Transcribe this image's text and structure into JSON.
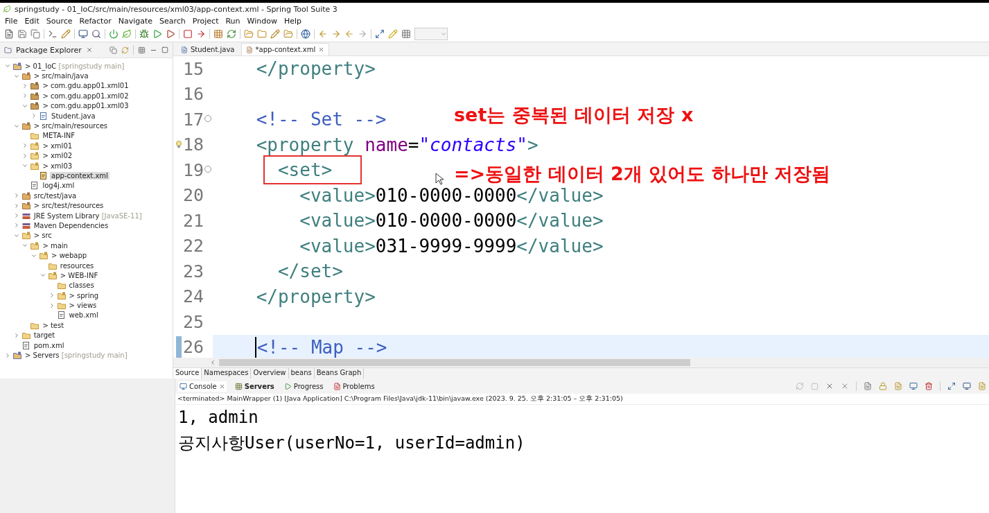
{
  "window": {
    "title": "springstudy - 01_IoC/src/main/resources/xml03/app-context.xml - Spring Tool Suite 3"
  },
  "menu": [
    "File",
    "Edit",
    "Source",
    "Refactor",
    "Navigate",
    "Search",
    "Project",
    "Run",
    "Window",
    "Help"
  ],
  "package_explorer": {
    "title": "Package Explorer",
    "items": [
      {
        "label": "> 01_IoC",
        "decoration": "[springstudy main]",
        "kind": "project",
        "expanded": true,
        "selected": false,
        "children": [
          {
            "label": "> src/main/java",
            "kind": "srcfolder",
            "expanded": true,
            "selected": false,
            "children": [
              {
                "label": "> com.gdu.app01.xml01",
                "kind": "package",
                "expanded": false,
                "selected": false
              },
              {
                "label": "> com.gdu.app01.xml02",
                "kind": "package",
                "expanded": false,
                "selected": false
              },
              {
                "label": "> com.gdu.app01.xml03",
                "kind": "package",
                "expanded": true,
                "selected": false,
                "children": [
                  {
                    "label": "Student.java",
                    "kind": "java",
                    "expanded": false,
                    "selected": false
                  }
                ]
              }
            ]
          },
          {
            "label": "> src/main/resources",
            "kind": "srcfolder",
            "expanded": true,
            "selected": false,
            "children": [
              {
                "label": "META-INF",
                "kind": "folder",
                "selected": false
              },
              {
                "label": "> xml01",
                "kind": "springfolder",
                "expanded": false,
                "selected": false
              },
              {
                "label": "> xml02",
                "kind": "springfolder",
                "expanded": false,
                "selected": false
              },
              {
                "label": "> xml03",
                "kind": "springfolder",
                "expanded": true,
                "selected": false,
                "children": [
                  {
                    "label": "app-context.xml",
                    "kind": "springxml",
                    "selected": true
                  }
                ]
              },
              {
                "label": "log4j.xml",
                "kind": "xml",
                "selected": false
              }
            ]
          },
          {
            "label": "src/test/java",
            "kind": "srcfolder",
            "expanded": false,
            "selected": false
          },
          {
            "label": "> src/test/resources",
            "kind": "srcfolder",
            "expanded": false,
            "selected": false
          },
          {
            "label": "JRE System Library",
            "decoration": "[JavaSE-11]",
            "kind": "library",
            "expanded": false,
            "selected": false
          },
          {
            "label": "Maven Dependencies",
            "kind": "library",
            "expanded": false,
            "selected": false
          },
          {
            "label": "> src",
            "kind": "springfolder",
            "expanded": true,
            "selected": false,
            "children": [
              {
                "label": "> main",
                "kind": "springfolder",
                "expanded": true,
                "selected": false,
                "children": [
                  {
                    "label": "> webapp",
                    "kind": "springfolder",
                    "expanded": true,
                    "selected": false,
                    "children": [
                      {
                        "label": "resources",
                        "kind": "folder",
                        "selected": false
                      },
                      {
                        "label": "> WEB-INF",
                        "kind": "springfolder",
                        "expanded": true,
                        "selected": false,
                        "children": [
                          {
                            "label": "classes",
                            "kind": "folder",
                            "selected": false
                          },
                          {
                            "label": "> spring",
                            "kind": "springfolder",
                            "expanded": false,
                            "selected": false
                          },
                          {
                            "label": "> views",
                            "kind": "folder",
                            "expanded": false,
                            "selected": false
                          },
                          {
                            "label": "web.xml",
                            "kind": "xml",
                            "selected": false
                          }
                        ]
                      }
                    ]
                  }
                ]
              },
              {
                "label": "> test",
                "kind": "folder",
                "selected": false
              }
            ]
          },
          {
            "label": "target",
            "kind": "folder",
            "expanded": false,
            "selected": false
          },
          {
            "label": "pom.xml",
            "kind": "xml",
            "selected": false
          }
        ]
      },
      {
        "label": "> Servers",
        "decoration": "[springstudy main]",
        "kind": "project",
        "expanded": false,
        "selected": false
      }
    ]
  },
  "editor": {
    "tabs": [
      {
        "label": "Student.java",
        "kind": "java",
        "selected": false
      },
      {
        "label": "*app-context.xml",
        "kind": "xml",
        "selected": true
      }
    ],
    "lines": [
      {
        "number": "15",
        "current": false,
        "foldable": false,
        "gutter_mark": false,
        "tokens": [
          {
            "kind": "tag",
            "text": "    </property>"
          }
        ]
      },
      {
        "number": "16",
        "current": false,
        "foldable": false,
        "gutter_mark": false
      },
      {
        "number": "17",
        "current": false,
        "foldable": true,
        "gutter_mark": false,
        "tokens": [
          {
            "kind": "comment",
            "text": "    <!-- Set -->"
          }
        ]
      },
      {
        "number": "18",
        "current": false,
        "foldable": false,
        "gutter_mark": true,
        "tokens": [
          {
            "kind": "tag",
            "text": "    <property"
          },
          {
            "kind": "attr",
            "text": " name"
          },
          {
            "kind": "text",
            "text": "="
          },
          {
            "kind": "string",
            "text": "\"contacts\""
          },
          {
            "kind": "tag",
            "text": ">"
          }
        ]
      },
      {
        "number": "19",
        "current": false,
        "foldable": true,
        "gutter_mark": false,
        "tokens": [
          {
            "kind": "tag",
            "text": "      <set>"
          }
        ]
      },
      {
        "number": "20",
        "current": false,
        "foldable": false,
        "gutter_mark": false,
        "tokens": [
          {
            "kind": "tag",
            "text": "        <value>"
          },
          {
            "kind": "text",
            "text": "010-0000-0000"
          },
          {
            "kind": "tag",
            "text": "</value>"
          }
        ]
      },
      {
        "number": "21",
        "current": false,
        "foldable": false,
        "gutter_mark": false,
        "tokens": [
          {
            "kind": "tag",
            "text": "        <value>"
          },
          {
            "kind": "text",
            "text": "010-0000-0000"
          },
          {
            "kind": "tag",
            "text": "</value>"
          }
        ]
      },
      {
        "number": "22",
        "current": false,
        "foldable": false,
        "gutter_mark": false,
        "tokens": [
          {
            "kind": "tag",
            "text": "        <value>"
          },
          {
            "kind": "text",
            "text": "031-9999-9999"
          },
          {
            "kind": "tag",
            "text": "</value>"
          }
        ]
      },
      {
        "number": "23",
        "current": false,
        "foldable": false,
        "gutter_mark": false,
        "tokens": [
          {
            "kind": "tag",
            "text": "      </set>"
          }
        ]
      },
      {
        "number": "24",
        "current": false,
        "foldable": false,
        "gutter_mark": false,
        "tokens": [
          {
            "kind": "tag",
            "text": "    </property>"
          }
        ]
      },
      {
        "number": "25",
        "current": false,
        "foldable": false,
        "gutter_mark": false
      },
      {
        "number": "26",
        "current": true,
        "foldable": false,
        "gutter_mark": false,
        "tokens": [
          {
            "kind": "comment",
            "text": "    <!-- Map -->"
          }
        ]
      }
    ],
    "annotations": [
      "set는 중복된 데이터 저장 x",
      "=>동일한 데이터 2개 있어도 하나만 저장됨"
    ],
    "bottom_tabs": [
      {
        "label": "Source",
        "selected": true
      },
      {
        "label": "Namespaces",
        "selected": false
      },
      {
        "label": "Overview",
        "selected": false
      },
      {
        "label": "beans",
        "selected": false
      },
      {
        "label": "Beans Graph",
        "selected": false
      }
    ]
  },
  "console": {
    "tabs": [
      {
        "label": "Console",
        "kind": "console",
        "selected": true
      },
      {
        "label": "Servers",
        "kind": "servers",
        "selected": false
      },
      {
        "label": "Progress",
        "kind": "progress",
        "selected": false
      },
      {
        "label": "Problems",
        "kind": "problems",
        "selected": false
      }
    ],
    "status": "<terminated> MainWrapper (1) [Java Application] C:\\Program Files\\Java\\jdk-11\\bin\\javaw.exe  (2023. 9. 25. 오후 2:31:05 – 오후 2:31:05)",
    "output": [
      "1, admin",
      "공지사항User(userNo=1, userId=admin)"
    ]
  }
}
